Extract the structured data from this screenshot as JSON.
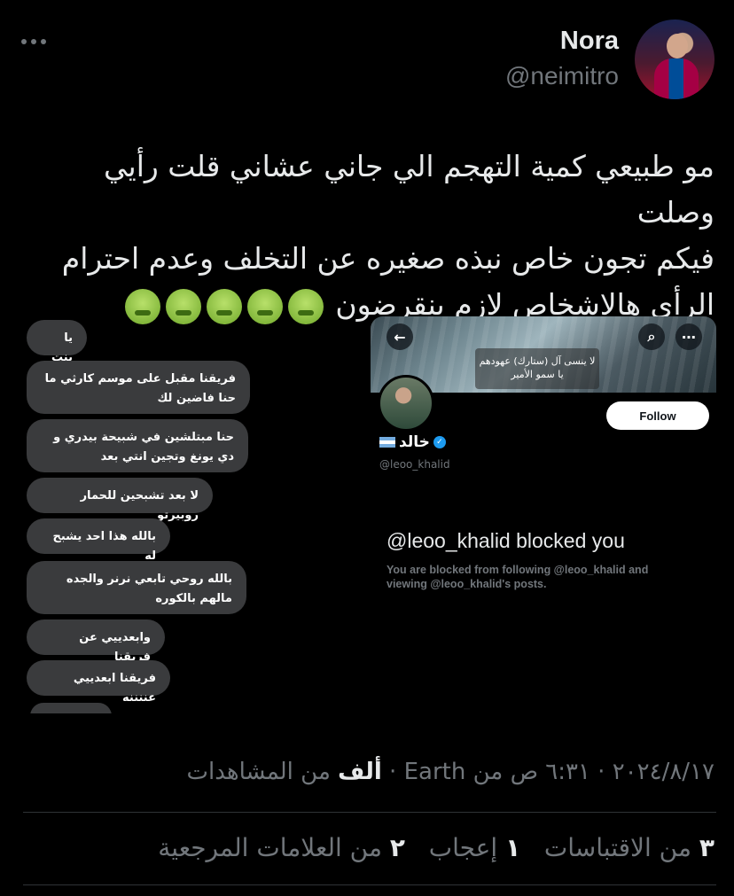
{
  "tweet": {
    "author_name": "Nora",
    "author_handle": "@neimitro",
    "text_line1": "مو طبيعي كمية التهجم الي جاني عشاني قلت رأيي وصلت",
    "text_line2": "فيكم تجون خاص نبذه صغيره عن التخلف وعدم احترام",
    "text_line3": "الرأي هالاشخاص لازم ينقرضون",
    "emoji_icon": "nauseated-face-icon",
    "emoji_count": 5
  },
  "chat_screenshot": {
    "messages": [
      "يا بنت",
      "فريقنا مقبل على موسم كارثي ما حنا فاضين لك",
      "حنا مبتلشين في شبيحة بيدري و دي يونغ وتجين انتي بعد",
      "لا بعد تشبحين للحمار روبيرتو",
      "بالله هذا احد يشبح له",
      "بالله روحي تابعي نرنر والجده مالهم بالكوره",
      "وابعدييي عن فريقنا",
      "فريقنا ابعدييي عننننه"
    ]
  },
  "profile_screenshot": {
    "banner_caption_line1": "لا ينسى آل (ستارك) عهودهم",
    "banner_caption_line2": "يا سمو الأمير",
    "follow_label": "Follow",
    "name": "خالد",
    "handle": "@leoo_khalid",
    "blocked_title": "@leoo_khalid blocked you",
    "blocked_line1": "You are blocked from following @leoo_khalid and",
    "blocked_line2": "viewing @leoo_khalid's posts."
  },
  "meta": {
    "date": "٢٠٢٤/٨/١٧",
    "time": "٦:٣١ ص",
    "source_prefix": "من",
    "source": "Earth",
    "views_count": "ألف",
    "views_label": "من المشاهدات"
  },
  "stats": {
    "quotes_count": "٣",
    "quotes_label": "من الاقتباسات",
    "likes_count": "١",
    "likes_label": "إعجاب",
    "bookmarks_count": "٢",
    "bookmarks_label": "من العلامات المرجعية"
  },
  "colors": {
    "background": "#000000",
    "primary_text": "#e7e9ea",
    "secondary_text": "#71767b",
    "bubble": "#3a3b3d",
    "verified": "#1d9bf0"
  }
}
